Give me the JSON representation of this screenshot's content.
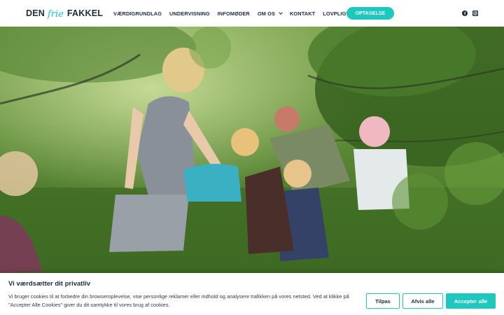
{
  "header": {
    "logo": {
      "word1": "DEN",
      "script": "frie",
      "word2": "FAKKEL"
    },
    "nav": [
      {
        "label": "VÆRDIGRUNDLAG",
        "dropdown": false
      },
      {
        "label": "UNDERVISNING",
        "dropdown": false
      },
      {
        "label": "INFOMØDER",
        "dropdown": false
      },
      {
        "label": "OM OS",
        "dropdown": true
      },
      {
        "label": "KONTAKT",
        "dropdown": false
      },
      {
        "label": "LOVPLIGTIG INFO",
        "dropdown": true
      }
    ],
    "cta_label": "OPTAGELSE",
    "social_icons": [
      "facebook-icon",
      "instagram-icon"
    ],
    "accent_color": "#1fc8be"
  },
  "hero": {
    "image": "children-and-adult-in-green-meadow-photo"
  },
  "cookie_banner": {
    "title": "Vi værdsætter dit privatliv",
    "text": "Vi bruger cookies til at forbedre din browseroplevelse, vise personlige reklamer eller indhold og analysere trafikken på vores netsted. Ved at klikke på \"Accepter Alle Cookies\" giver du dit samtykke til vores brug af cookies.",
    "buttons": {
      "customize": "Tilpas",
      "reject": "Afvis alle",
      "accept": "Accepter alle"
    }
  }
}
